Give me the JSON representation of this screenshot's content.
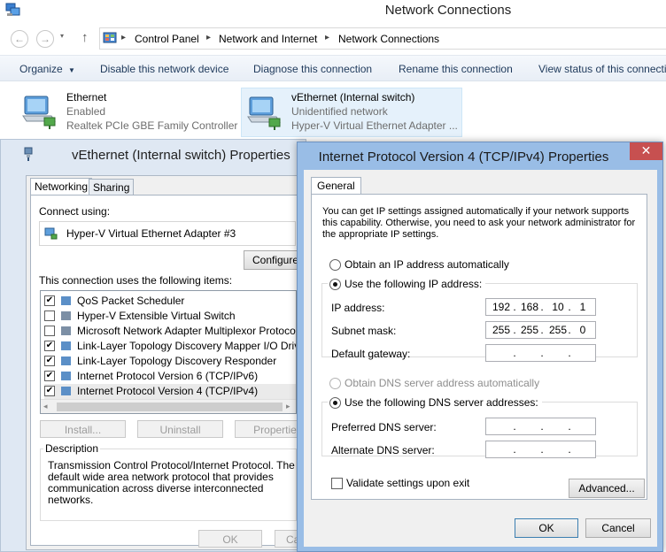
{
  "explorer": {
    "title": "Network Connections",
    "breadcrumbs": [
      "Control Panel",
      "Network and Internet",
      "Network Connections"
    ],
    "commands": [
      "Organize",
      "Disable this network device",
      "Diagnose this connection",
      "Rename this connection",
      "View status of this connectio"
    ],
    "adapters": [
      {
        "name": "Ethernet",
        "status": "Enabled",
        "device": "Realtek PCIe GBE Family Controller"
      },
      {
        "name": "vEthernet (Internal switch)",
        "status": "Unidentified network",
        "device": "Hyper-V Virtual Ethernet Adapter ..."
      }
    ]
  },
  "veth": {
    "title": "vEthernet (Internal switch) Properties",
    "tabs": [
      "Networking",
      "Sharing"
    ],
    "connect_using_label": "Connect using:",
    "adapter": "Hyper-V Virtual Ethernet Adapter #3",
    "configure_label": "Configure",
    "items_label": "This connection uses the following items:",
    "items": [
      {
        "label": "QoS Packet Scheduler",
        "checked": true
      },
      {
        "label": "Hyper-V Extensible Virtual Switch",
        "checked": false
      },
      {
        "label": "Microsoft Network Adapter Multiplexor Protocol",
        "checked": false
      },
      {
        "label": "Link-Layer Topology Discovery Mapper I/O Driver",
        "checked": true
      },
      {
        "label": "Link-Layer Topology Discovery Responder",
        "checked": true
      },
      {
        "label": "Internet Protocol Version 6 (TCP/IPv6)",
        "checked": true
      },
      {
        "label": "Internet Protocol Version 4 (TCP/IPv4)",
        "checked": true
      }
    ],
    "install_label": "Install...",
    "uninstall_label": "Uninstall",
    "properties_label": "Properties",
    "description_label": "Description",
    "description_text": "Transmission Control Protocol/Internet Protocol. The default wide area network protocol that provides communication across diverse interconnected networks.",
    "ok_label": "OK",
    "cancel_label": "Ca"
  },
  "ipv4": {
    "title": "Internet Protocol Version 4 (TCP/IPv4) Properties",
    "close_glyph": "✕",
    "tab": "General",
    "intro": "You can get IP settings assigned automatically if your network supports this capability. Otherwise, you need to ask your network administrator for the appropriate IP settings.",
    "obtain_ip_auto": "Obtain an IP address automatically",
    "use_following_ip": "Use the following IP address:",
    "ip_label": "IP address:",
    "ip": [
      "192",
      "168",
      "10",
      "1"
    ],
    "subnet_label": "Subnet mask:",
    "subnet": [
      "255",
      "255",
      "255",
      "0"
    ],
    "gateway_label": "Default gateway:",
    "gateway": [
      "",
      "",
      "",
      ""
    ],
    "obtain_dns_auto": "Obtain DNS server address automatically",
    "use_following_dns": "Use the following DNS server addresses:",
    "preferred_label": "Preferred DNS server:",
    "preferred": [
      "",
      "",
      "",
      ""
    ],
    "alternate_label": "Alternate DNS server:",
    "alternate": [
      "",
      "",
      "",
      ""
    ],
    "validate_label": "Validate settings upon exit",
    "advanced_label": "Advanced...",
    "ok_label": "OK",
    "cancel_label": "Cancel"
  }
}
